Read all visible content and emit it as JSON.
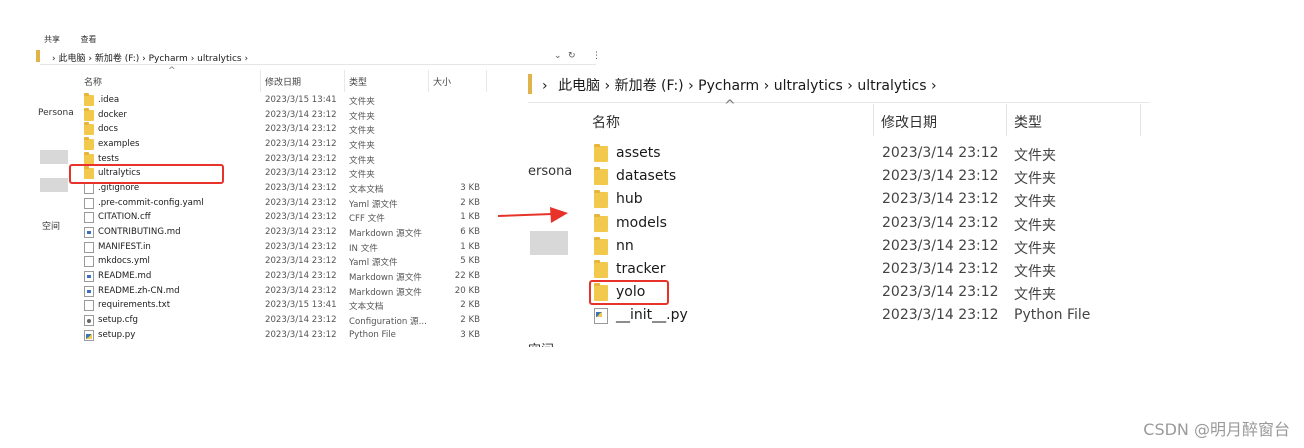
{
  "left": {
    "ribbon_items": [
      "共享",
      "查看"
    ],
    "breadcrumb": [
      "此电脑",
      "新加卷 (F:)",
      "Pycharm",
      "ultralytics"
    ],
    "columns": {
      "name": "名称",
      "date": "修改日期",
      "type": "类型",
      "size": "大小"
    },
    "sidebar": {
      "top": "Persona",
      "bottom": "空间"
    },
    "rows": [
      {
        "icon": "folder",
        "name": ".idea",
        "date": "2023/3/15 13:41",
        "type": "文件夹",
        "size": ""
      },
      {
        "icon": "folder",
        "name": "docker",
        "date": "2023/3/14 23:12",
        "type": "文件夹",
        "size": ""
      },
      {
        "icon": "folder",
        "name": "docs",
        "date": "2023/3/14 23:12",
        "type": "文件夹",
        "size": ""
      },
      {
        "icon": "folder",
        "name": "examples",
        "date": "2023/3/14 23:12",
        "type": "文件夹",
        "size": ""
      },
      {
        "icon": "folder",
        "name": "tests",
        "date": "2023/3/14 23:12",
        "type": "文件夹",
        "size": ""
      },
      {
        "icon": "folder",
        "name": "ultralytics",
        "date": "2023/3/14 23:12",
        "type": "文件夹",
        "size": ""
      },
      {
        "icon": "file",
        "name": ".gitignore",
        "date": "2023/3/14 23:12",
        "type": "文本文档",
        "size": "3 KB"
      },
      {
        "icon": "file",
        "name": ".pre-commit-config.yaml",
        "date": "2023/3/14 23:12",
        "type": "Yaml 源文件",
        "size": "2 KB"
      },
      {
        "icon": "file",
        "name": "CITATION.cff",
        "date": "2023/3/14 23:12",
        "type": "CFF 文件",
        "size": "1 KB"
      },
      {
        "icon": "md",
        "name": "CONTRIBUTING.md",
        "date": "2023/3/14 23:12",
        "type": "Markdown 源文件",
        "size": "6 KB"
      },
      {
        "icon": "file",
        "name": "MANIFEST.in",
        "date": "2023/3/14 23:12",
        "type": "IN 文件",
        "size": "1 KB"
      },
      {
        "icon": "file",
        "name": "mkdocs.yml",
        "date": "2023/3/14 23:12",
        "type": "Yaml 源文件",
        "size": "5 KB"
      },
      {
        "icon": "md",
        "name": "README.md",
        "date": "2023/3/14 23:12",
        "type": "Markdown 源文件",
        "size": "22 KB"
      },
      {
        "icon": "md",
        "name": "README.zh-CN.md",
        "date": "2023/3/14 23:12",
        "type": "Markdown 源文件",
        "size": "20 KB"
      },
      {
        "icon": "file",
        "name": "requirements.txt",
        "date": "2023/3/15 13:41",
        "type": "文本文档",
        "size": "2 KB"
      },
      {
        "icon": "cfg",
        "name": "setup.cfg",
        "date": "2023/3/14 23:12",
        "type": "Configuration 源...",
        "size": "2 KB"
      },
      {
        "icon": "py",
        "name": "setup.py",
        "date": "2023/3/14 23:12",
        "type": "Python File",
        "size": "3 KB"
      }
    ]
  },
  "right": {
    "breadcrumb": [
      "此电脑",
      "新加卷 (F:)",
      "Pycharm",
      "ultralytics",
      "ultralytics"
    ],
    "columns": {
      "name": "名称",
      "date": "修改日期",
      "type": "类型"
    },
    "sidebar": {
      "top": "ersona",
      "bottom": "空间"
    },
    "rows": [
      {
        "icon": "folder",
        "name": "assets",
        "date": "2023/3/14 23:12",
        "type": "文件夹"
      },
      {
        "icon": "folder",
        "name": "datasets",
        "date": "2023/3/14 23:12",
        "type": "文件夹"
      },
      {
        "icon": "folder",
        "name": "hub",
        "date": "2023/3/14 23:12",
        "type": "文件夹"
      },
      {
        "icon": "folder",
        "name": "models",
        "date": "2023/3/14 23:12",
        "type": "文件夹"
      },
      {
        "icon": "folder",
        "name": "nn",
        "date": "2023/3/14 23:12",
        "type": "文件夹"
      },
      {
        "icon": "folder",
        "name": "tracker",
        "date": "2023/3/14 23:12",
        "type": "文件夹"
      },
      {
        "icon": "folder",
        "name": "yolo",
        "date": "2023/3/14 23:12",
        "type": "文件夹"
      },
      {
        "icon": "py",
        "name": "__init__.py",
        "date": "2023/3/14 23:12",
        "type": "Python File"
      }
    ]
  },
  "colors": {
    "highlight": "#e8332a",
    "folder": "#f2c94c"
  },
  "watermark": "CSDN @明月醉窗台"
}
